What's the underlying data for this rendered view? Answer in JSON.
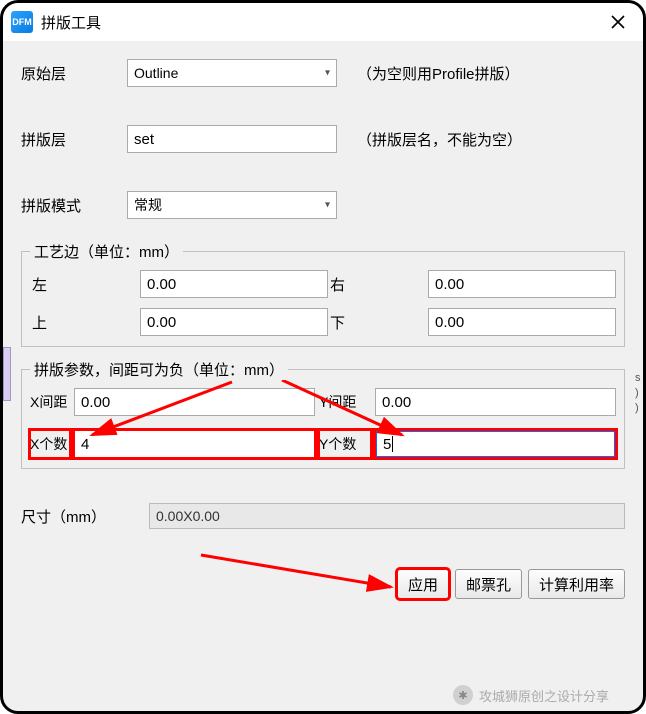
{
  "app_icon_text": "DFM",
  "title": "拼版工具",
  "rows": {
    "original_layer": {
      "label": "原始层",
      "value": "Outline",
      "hint": "（为空则用Profile拼版）"
    },
    "panel_layer": {
      "label": "拼版层",
      "value": "set",
      "hint": "（拼版层名，不能为空）"
    },
    "panel_mode": {
      "label": "拼版模式",
      "value": "常规"
    }
  },
  "edge_group": {
    "legend": "工艺边（单位：mm）",
    "left": {
      "label": "左",
      "value": "0.00"
    },
    "right": {
      "label": "右",
      "value": "0.00"
    },
    "top": {
      "label": "上",
      "value": "0.00"
    },
    "bottom": {
      "label": "下",
      "value": "0.00"
    }
  },
  "param_group": {
    "legend": "拼版参数，间距可为负（单位：mm）",
    "x_gap": {
      "label": "X间距",
      "value": "0.00"
    },
    "y_gap": {
      "label": "Y间距",
      "value": "0.00"
    },
    "x_count": {
      "label": "X个数",
      "value": "4"
    },
    "y_count": {
      "label": "Y个数",
      "value": "5"
    }
  },
  "size": {
    "label": "尺寸（mm）",
    "value": "0.00X0.00"
  },
  "buttons": {
    "apply": "应用",
    "stamp": "邮票孔",
    "calc": "计算利用率"
  },
  "watermark": "攻城狮原创之设计分享"
}
